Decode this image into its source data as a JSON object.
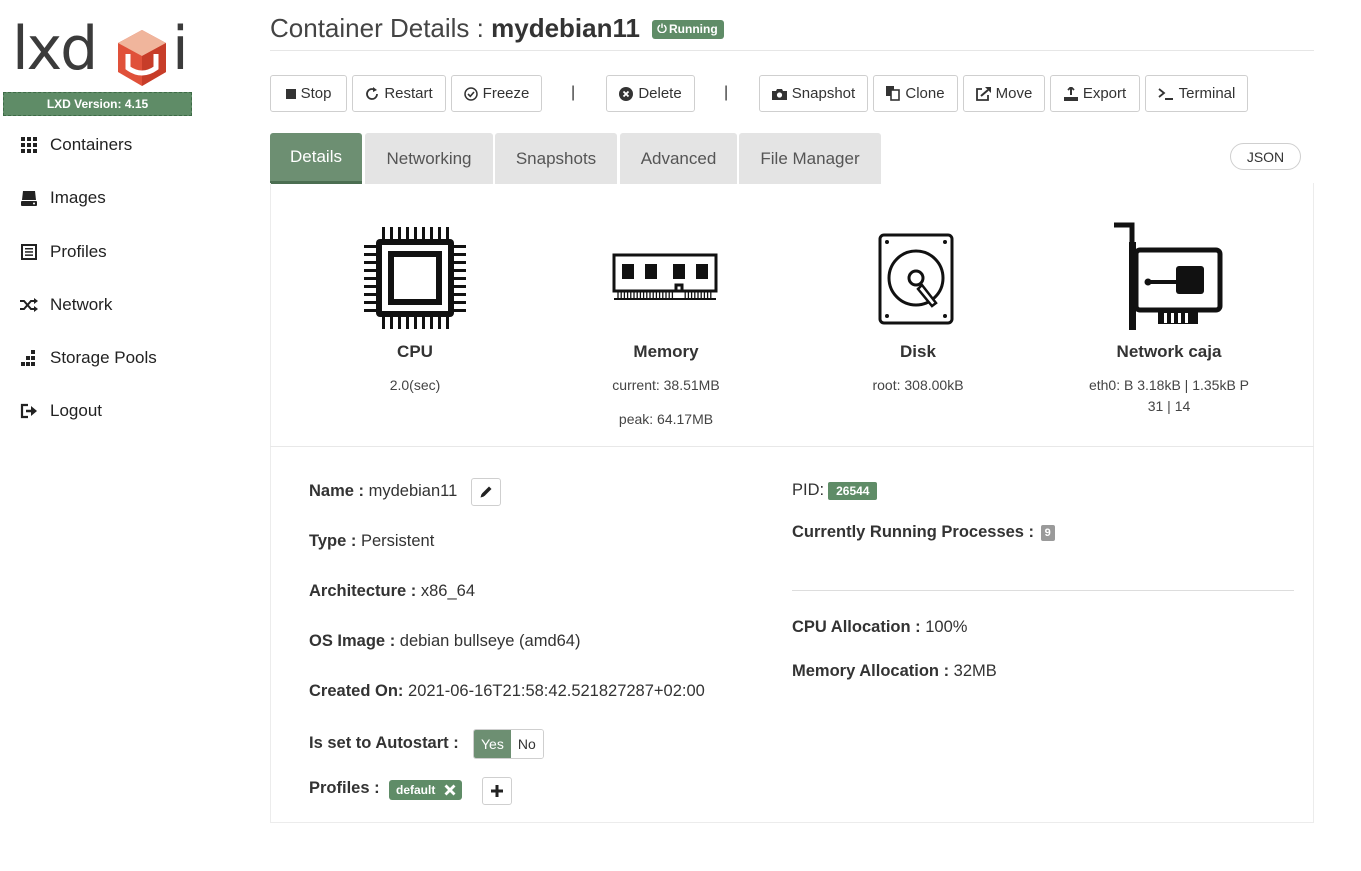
{
  "sidebar": {
    "logo_text": "lxdui",
    "version": "LXD Version: 4.15",
    "items": [
      {
        "label": "Containers",
        "icon": "grid-icon"
      },
      {
        "label": "Images",
        "icon": "drive-icon"
      },
      {
        "label": "Profiles",
        "icon": "list-icon"
      },
      {
        "label": "Network",
        "icon": "shuffle-icon"
      },
      {
        "label": "Storage Pools",
        "icon": "storage-icon"
      },
      {
        "label": "Logout",
        "icon": "logout-icon"
      }
    ]
  },
  "header": {
    "title_prefix": "Container Details : ",
    "container_name": "mydebian11",
    "status": "Running"
  },
  "toolbar": {
    "stop": "Stop",
    "restart": "Restart",
    "freeze": "Freeze",
    "separator": "|",
    "delete": "Delete",
    "snapshot": "Snapshot",
    "clone": "Clone",
    "move": "Move",
    "export": "Export",
    "terminal": "Terminal"
  },
  "tabs": [
    {
      "label": "Details",
      "active": true
    },
    {
      "label": "Networking",
      "active": false
    },
    {
      "label": "Snapshots",
      "active": false
    },
    {
      "label": "Advanced",
      "active": false
    },
    {
      "label": "File Manager",
      "active": false
    }
  ],
  "json_button": "JSON",
  "metrics": {
    "cpu": {
      "title": "CPU",
      "value": "2.0(sec)"
    },
    "memory": {
      "title": "Memory",
      "current": "current: 38.51MB",
      "peak": "peak: 64.17MB"
    },
    "disk": {
      "title": "Disk",
      "value": "root: 308.00kB"
    },
    "network": {
      "title": "Network caja",
      "line1": "eth0: B 3.18kB | 1.35kB P",
      "line2": "31 | 14"
    }
  },
  "details": {
    "name_label": "Name : ",
    "name_value": "mydebian11",
    "type_label": "Type : ",
    "type_value": "Persistent",
    "arch_label": "Architecture : ",
    "arch_value": "x86_64",
    "os_label": "OS Image : ",
    "os_value": "debian bullseye (amd64)",
    "created_label": "Created On: ",
    "created_value": "2021-06-16T21:58:42.521827287+02:00",
    "autostart_label": "Is set to Autostart : ",
    "autostart_yes": "Yes",
    "autostart_no": "No",
    "profiles_label": "Profiles : ",
    "profiles": [
      "default"
    ],
    "pid_label": "PID:",
    "pid_value": "26544",
    "processes_label": "Currently Running Processes : ",
    "processes_value": "9",
    "cpu_alloc_label": "CPU Allocation : ",
    "cpu_alloc_value": "100%",
    "mem_alloc_label": "Memory Allocation : ",
    "mem_alloc_value": "32MB"
  },
  "colors": {
    "accent": "#5f8c67",
    "tab_active": "#6d8f72",
    "tab_inactive": "#e4e4e4",
    "logo_orange": "#e0513a"
  }
}
